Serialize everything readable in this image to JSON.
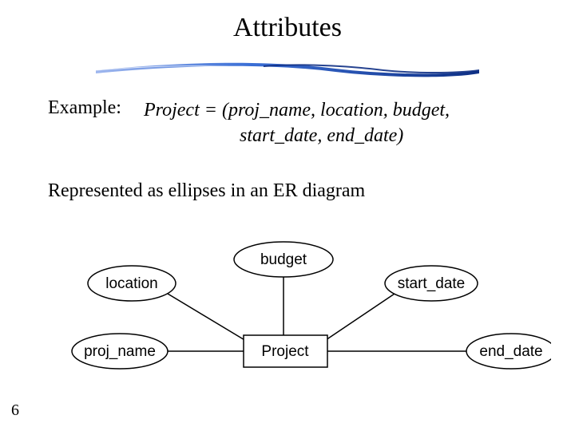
{
  "title": "Attributes",
  "example": {
    "label": "Example:",
    "line1": "Project = (proj_name, location, budget,",
    "line2": "start_date, end_date)"
  },
  "represented": "Represented as ellipses in an ER diagram",
  "er": {
    "entity": "Project",
    "attributes": {
      "budget": "budget",
      "location": "location",
      "proj_name": "proj_name",
      "start_date": "start_date",
      "end_date": "end_date"
    }
  },
  "page_number": "6",
  "colors": {
    "accent_blue": "#3b6fd6",
    "accent_dark": "#102a6e"
  }
}
